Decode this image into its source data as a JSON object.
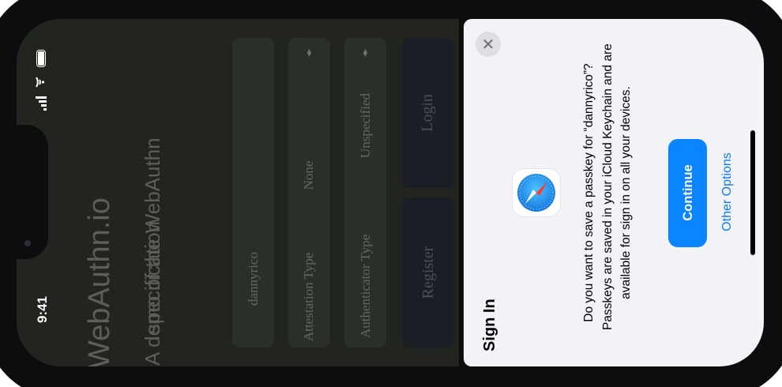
{
  "status_bar": {
    "time": "9:41"
  },
  "webpage": {
    "title": "WebAuthn.io",
    "subtitle_line1": "A demo of the WebAuthn",
    "subtitle_line2": "specification",
    "username_value": "dannyrico",
    "attestation_label": "Attestation Type",
    "attestation_value": "None",
    "authenticator_label": "Authenticator Type",
    "authenticator_value": "Unspecified",
    "register_label": "Register",
    "login_label": "Login"
  },
  "sheet": {
    "title": "Sign In",
    "message_line1": "Do you want to save a passkey for “dannyrico”?",
    "message_line2": "Passkeys are saved in your iCloud Keychain and are",
    "message_line3": "available for sign in on all your devices.",
    "continue_label": "Continue",
    "other_options_label": "Other Options"
  },
  "colors": {
    "accent": "#0a84ff",
    "sheet_bg": "#f2f2f7",
    "page_bg": "#292d26"
  }
}
